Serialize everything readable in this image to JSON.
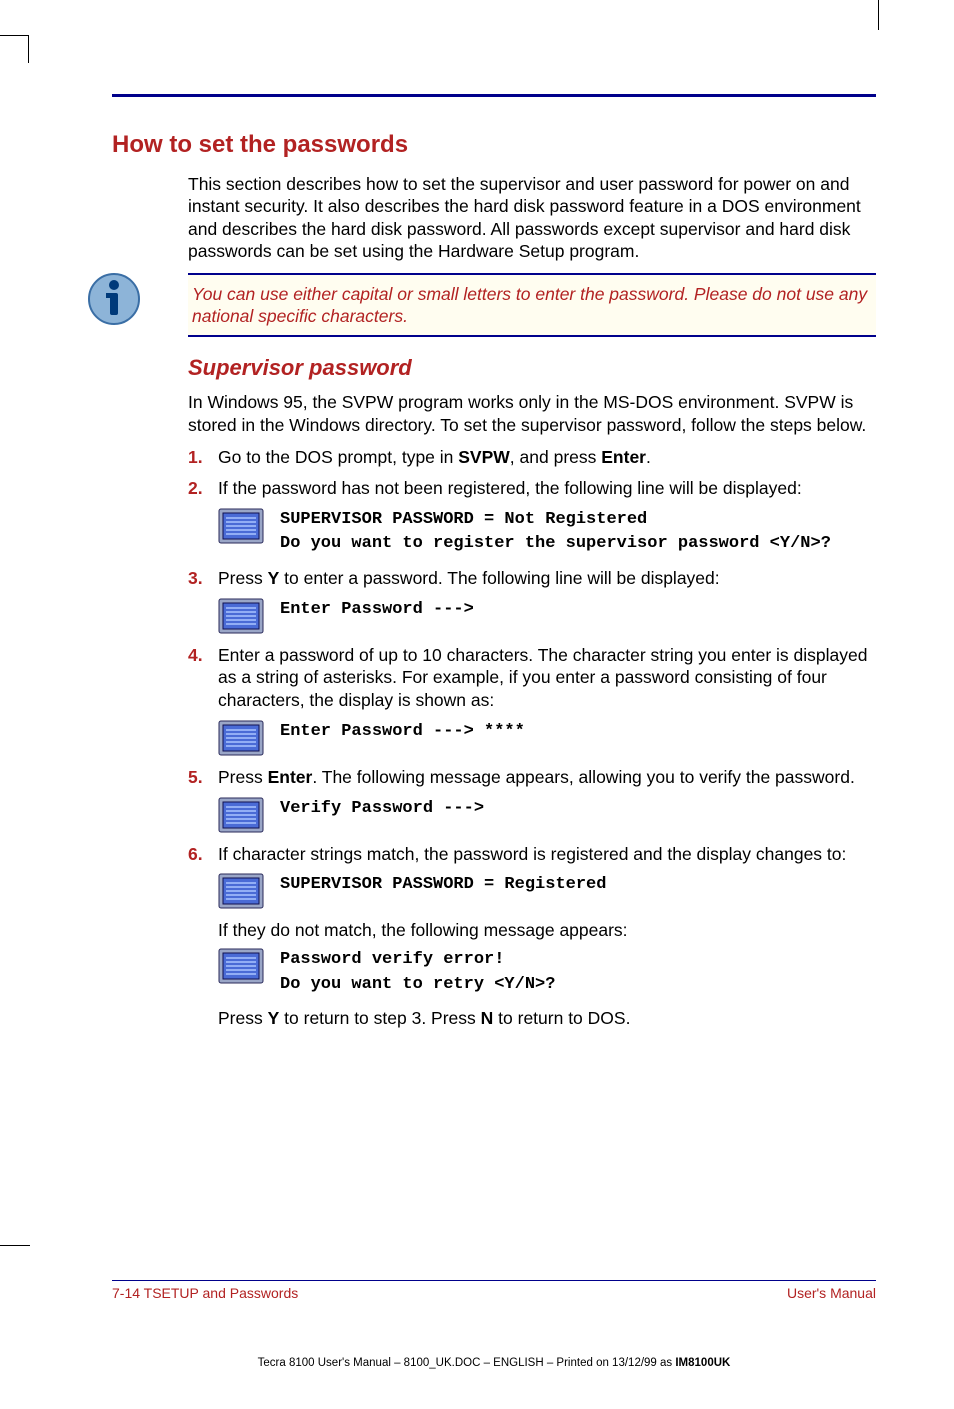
{
  "heading1": "How to set the passwords",
  "intro": "This section describes how to set the supervisor and user password for power on and instant security. It also describes the hard disk password feature in a DOS environment and describes the hard disk password. All passwords except supervisor and hard disk passwords can be set using the Hardware Setup program.",
  "note": "You can use either capital or small letters to enter the password. Please do not use any national specific characters.",
  "heading2": "Supervisor password",
  "sub_intro": "In Windows 95, the SVPW program works only in the MS-DOS environment. SVPW is stored in the Windows directory. To set the supervisor password, follow the steps below.",
  "steps": {
    "s1_num": "1.",
    "s1_a": "Go to the DOS prompt, type in ",
    "s1_b": "SVPW",
    "s1_c": ", and press ",
    "s1_d": "Enter",
    "s1_e": ".",
    "s2_num": "2.",
    "s2": "If the password has not been registered, the following line will be displayed:",
    "s2_screen": "SUPERVISOR PASSWORD = Not Registered\nDo you want to register the supervisor password <Y/N>?",
    "s3_num": "3.",
    "s3_a": "Press ",
    "s3_b": "Y",
    "s3_c": " to enter a password. The following line will be displayed:",
    "s3_screen": "Enter Password --->",
    "s4_num": "4.",
    "s4": "Enter a password of up to 10 characters. The character string you enter is displayed as a string of asterisks. For example, if you enter a password consisting of four characters, the display is shown as:",
    "s4_screen": "Enter Password ---> ****",
    "s5_num": "5.",
    "s5_a": "Press ",
    "s5_b": "Enter",
    "s5_c": ". The following message appears, allowing you to verify the password.",
    "s5_screen": "Verify Password --->",
    "s6_num": "6.",
    "s6": "If character strings match, the password is registered and the display changes to:",
    "s6_screen": "SUPERVISOR PASSWORD = Registered",
    "s6_after": "If they do not match, the following message appears:",
    "s6_screen2": "Password verify error!\nDo you want to retry <Y/N>?",
    "s6_final_a": "Press ",
    "s6_final_b": "Y",
    "s6_final_c": " to return to step 3. Press ",
    "s6_final_d": "N",
    "s6_final_e": " to return to DOS."
  },
  "footer_left": "7-14  TSETUP and Passwords",
  "footer_right": "User's Manual",
  "imprint_a": "Tecra 8100 User's Manual  – 8100_UK.DOC – ENGLISH – Printed on 13/12/99 as ",
  "imprint_b": "IM8100UK"
}
